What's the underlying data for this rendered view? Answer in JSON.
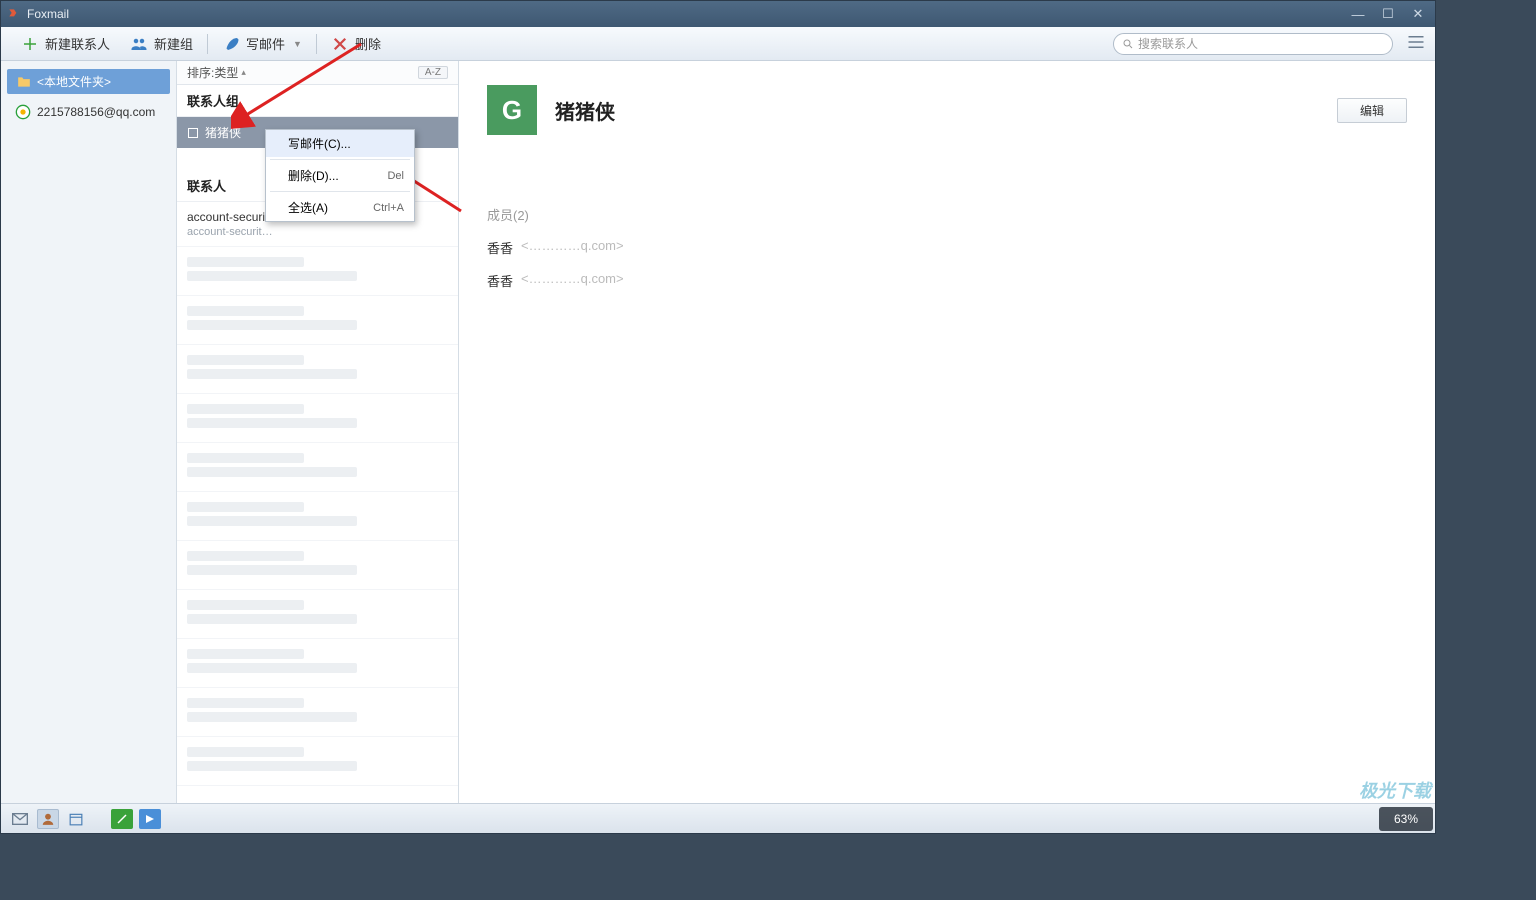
{
  "titlebar": {
    "app_name": "Foxmail"
  },
  "toolbar": {
    "new_contact": "新建联系人",
    "new_group": "新建组",
    "compose": "写邮件",
    "delete": "删除"
  },
  "search": {
    "placeholder": "搜索联系人"
  },
  "sidebar": {
    "local_folder": "<本地文件夹>",
    "account": "2215788156@qq.com"
  },
  "midcol": {
    "sort_label": "排序:类型",
    "az_label": "A-Z",
    "group_header": "联系人组",
    "selected_group": "猪猪侠",
    "contacts_header": "联系人",
    "contact1_name": "account-securi…",
    "contact1_sub": "account-securit…"
  },
  "context_menu": {
    "compose": "写邮件(C)...",
    "delete": "删除(D)...",
    "delete_shortcut": "Del",
    "select_all": "全选(A)",
    "select_all_shortcut": "Ctrl+A"
  },
  "detail": {
    "name": "猪猪侠",
    "avatar_letter": "G",
    "edit": "编辑",
    "members_label": "成员(2)",
    "member1_name": "香香",
    "member1_email": "<…………q.com>",
    "member2_name": "香香",
    "member2_email": "<…………q.com>"
  },
  "watermark": "极光下载",
  "zoom": "63%"
}
